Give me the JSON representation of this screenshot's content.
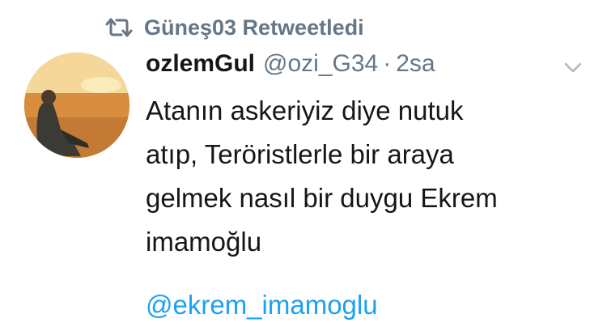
{
  "retweet": {
    "icon": "retweet-icon",
    "text": "Güneş03 Retweetledi"
  },
  "author": {
    "display_name": "ozlemGul",
    "username": "@ozi_G34",
    "separator": "·",
    "timestamp": "2sa",
    "avatar_icon": "avatar-photo"
  },
  "tweet": {
    "lines": [
      "Atanın askeriyiz diye nutuk",
      "atıp, Teröristlerle bir araya",
      "gelmek nasıl bir duygu Ekrem",
      "imamoğlu"
    ],
    "mention": "@ekrem_imamoglu"
  },
  "menu": {
    "icon": "chevron-down-icon"
  },
  "colors": {
    "text": "#14171a",
    "secondary": "#657786",
    "link": "#1da1f2",
    "background": "#ffffff"
  }
}
